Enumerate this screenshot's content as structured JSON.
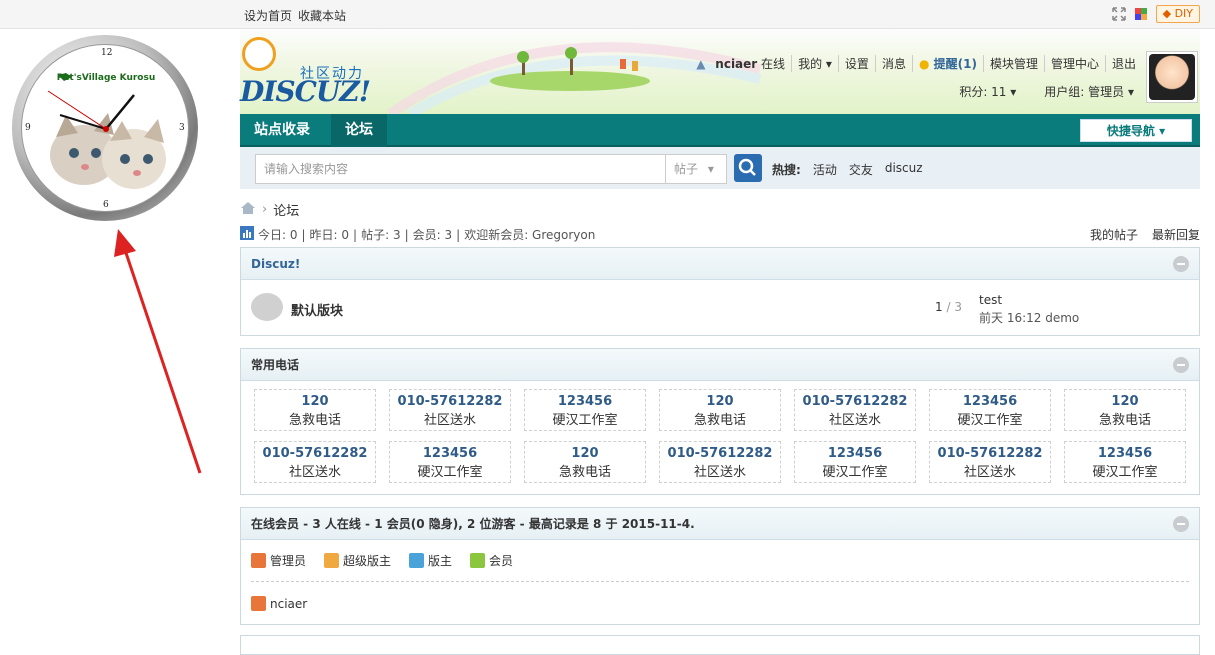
{
  "topbar": {
    "set_home": "设为首页",
    "bookmark": "收藏本站",
    "diy_label": "DIY"
  },
  "clock": {
    "brand": "Pet'sVillage Kurosu",
    "numbers": [
      "12",
      "3",
      "6",
      "9"
    ]
  },
  "header": {
    "slogan": "社区动力",
    "brand": "DISCUZ!",
    "username": "nciaer",
    "status": "在线",
    "menu": [
      "我的",
      "设置",
      "消息",
      "提醒(1)",
      "模块管理",
      "管理中心",
      "退出"
    ],
    "points": "积分: 11",
    "usergroup": "用户组: 管理员"
  },
  "nav": {
    "items": [
      "站点收录",
      "论坛"
    ],
    "quick": "快捷导航"
  },
  "search": {
    "placeholder": "请输入搜索内容",
    "type": "帖子",
    "hot_label": "热搜:",
    "hot": [
      "活动",
      "交友",
      "discuz"
    ]
  },
  "breadcrumb": {
    "current": "论坛"
  },
  "stats": {
    "today": "今日: 0",
    "yesterday": "昨日: 0",
    "posts": "帖子: 3",
    "members": "会员: 3",
    "welcome": "欢迎新会员: Gregoryon",
    "my_posts": "我的帖子",
    "latest": "最新回复"
  },
  "forum_group": {
    "title": "Discuz!",
    "forum_name": "默认版块",
    "threads": "1",
    "posts": "3",
    "last_title": "test",
    "last_meta": "前天 16:12 demo"
  },
  "phones": {
    "title": "常用电话",
    "items": [
      {
        "num": "120",
        "name": "急救电话"
      },
      {
        "num": "010-57612282",
        "name": "社区送水"
      },
      {
        "num": "123456",
        "name": "硬汉工作室"
      },
      {
        "num": "120",
        "name": "急救电话"
      },
      {
        "num": "010-57612282",
        "name": "社区送水"
      },
      {
        "num": "123456",
        "name": "硬汉工作室"
      },
      {
        "num": "120",
        "name": "急救电话"
      },
      {
        "num": "010-57612282",
        "name": "社区送水"
      },
      {
        "num": "123456",
        "name": "硬汉工作室"
      },
      {
        "num": "120",
        "name": "急救电话"
      },
      {
        "num": "010-57612282",
        "name": "社区送水"
      },
      {
        "num": "123456",
        "name": "硬汉工作室"
      },
      {
        "num": "010-57612282",
        "name": "社区送水"
      },
      {
        "num": "123456",
        "name": "硬汉工作室"
      }
    ]
  },
  "online": {
    "title": "在线会员 - 3 人在线 - 1 会员(0 隐身), 2 位游客 - 最高记录是 8 于 2015-11-4.",
    "legend": [
      "管理员",
      "超级版主",
      "版主",
      "会员"
    ],
    "users": [
      "nciaer"
    ]
  },
  "colors": {
    "nav_bg": "#0b7c7c",
    "link": "#336699"
  }
}
